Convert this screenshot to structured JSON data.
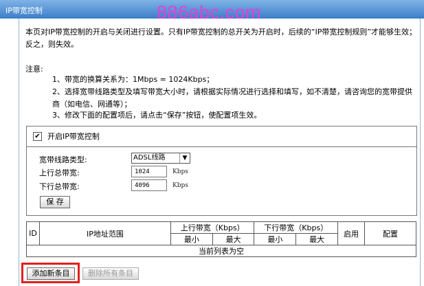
{
  "window": {
    "title": "IP带宽控制"
  },
  "watermark": "886abc.com",
  "intro": "本页对IP带宽控制的开启与关闭进行设置。只有IP带宽控制的总开关为开启时，后续的“IP带宽控制规则”才能够生效；反之，则失效。",
  "notes": {
    "title": "注意:",
    "items": [
      "1、带宽的换算关系为：1Mbps = 1024Kbps；",
      "2、选择宽带线路类型及填写带宽大小时，请根据实际情况进行选择和填写，如不清楚，请咨询您的宽带提供商（如电信、网通等）；",
      "3、修改下面的配置项后，请点击“保存”按钮，使配置项生效。"
    ]
  },
  "settings": {
    "enable_label": "开启IP带宽控制",
    "enable_checked": true,
    "line_type_label": "宽带线路类型:",
    "line_type_value": "ADSL线路",
    "up_label": "上行总带宽:",
    "up_value": "1024",
    "down_label": "下行总带宽:",
    "down_value": "4096",
    "unit": "Kbps",
    "save_label": "保 存"
  },
  "table": {
    "headers": {
      "id": "ID",
      "ip_range": "IP地址范围",
      "up_bw": "上行带宽（Kbps）",
      "down_bw": "下行带宽（Kbps）",
      "min": "最小",
      "max": "最大",
      "enable": "启用",
      "config": "配置"
    },
    "empty_text": "当前列表为空"
  },
  "buttons": {
    "add": "添加新条目",
    "delete_all": "删除所有条目"
  },
  "colors": {
    "titlebar": "#3c7ec9",
    "watermark": "#e43fd8",
    "highlight": "#e41e1e"
  }
}
